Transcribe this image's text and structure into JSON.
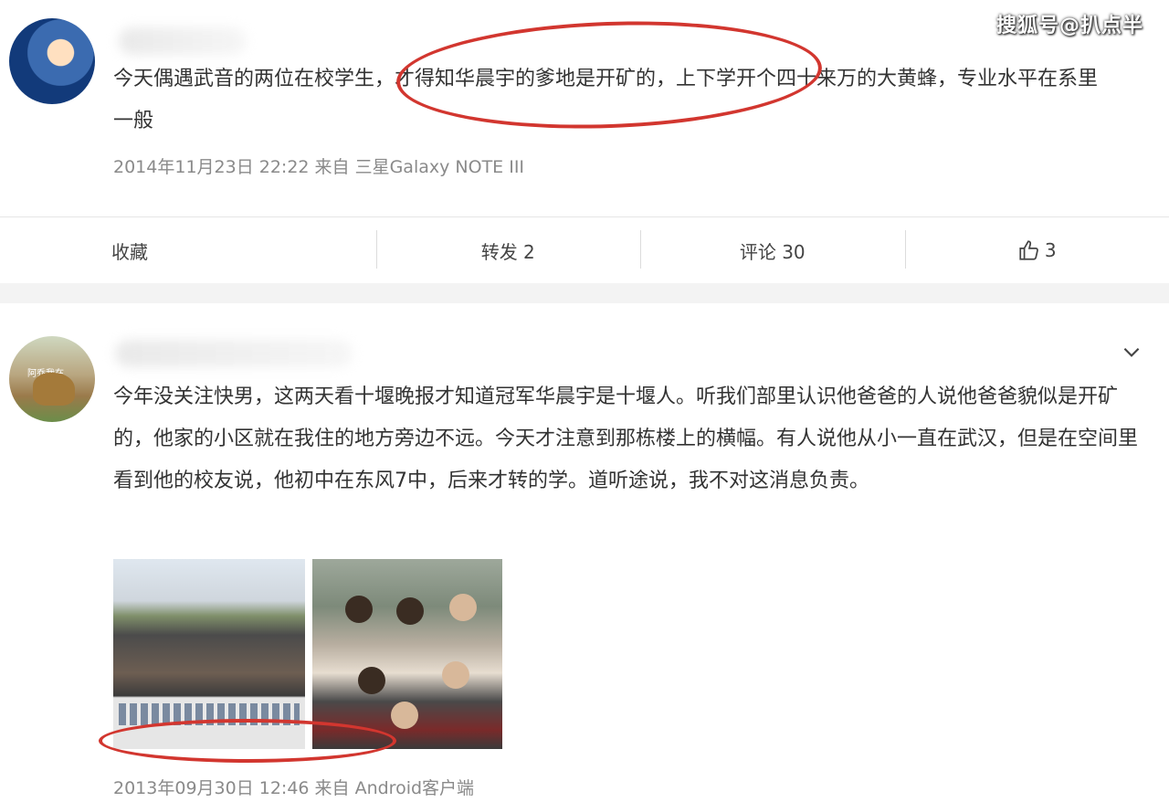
{
  "watermark": "搜狐号@扒点半",
  "posts": [
    {
      "text": "今天偶遇武音的两位在校学生，才得知华晨宇的爹地是开矿的，上下学开个四十来万的大黄蜂，专业水平在系里一般",
      "meta": "2014年11月23日 22:22 来自 三星Galaxy NOTE III",
      "actions": {
        "favorite": "收藏",
        "repost": "转发 2",
        "comment": "评论 30",
        "like": "3"
      }
    },
    {
      "avatar_text": "阿乔我在",
      "text": "今年没关注快男，这两天看十堰晚报才知道冠军华晨宇是十堰人。听我们部里认识他爸爸的人说他爸爸貌似是开矿的，他家的小区就在我住的地方旁边不远。今天才注意到那栋楼上的横幅。有人说他从小一直在武汉，但是在空间里看到他的校友说，他初中在东风7中，后来才转的学。道听途说，我不对这消息负责。",
      "meta": "2013年09月30日 12:46 来自 Android客户端"
    }
  ],
  "colors": {
    "highlight": "#d2362f",
    "meta": "#8a8a8a",
    "text": "#333333"
  },
  "icons": {
    "like": "thumbs-up-icon",
    "expand": "chevron-down-icon"
  }
}
